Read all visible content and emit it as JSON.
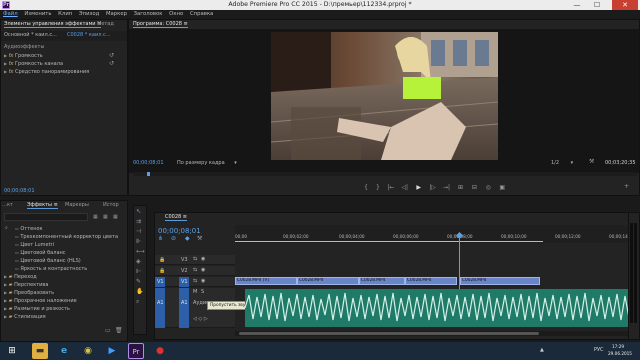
{
  "window": {
    "title": "Adobe Premiere Pro CC 2015 - D:\\премьер\\112334.prproj *",
    "app_icon": "Pr",
    "min": "—",
    "max": "☐",
    "close": "✕"
  },
  "menu": [
    "Файл",
    "Изменить",
    "Клип",
    "Эпизод",
    "Маркер",
    "Заголовок",
    "Окно",
    "Справка"
  ],
  "effect_controls": {
    "tabs": [
      "Элементы управления эффектами ≡",
      "Метад"
    ],
    "source_label": "Основной * каил.c...",
    "clip_label": "C0028 * каил.c...",
    "section": "Аудиоэффекты",
    "items": [
      {
        "name": "Громкость"
      },
      {
        "name": "Громкость канала"
      },
      {
        "name": "Средство панорамирования"
      }
    ],
    "timecode": "00;00;08;01"
  },
  "program_monitor": {
    "tab": "Программа: C0028 ≡",
    "timecode": "00;00;08;01",
    "fit": "По размеру кадра",
    "fit_arrow": "▾",
    "ratio": "1/2",
    "ratio_arrow": "▾",
    "duration": "00;03;20;35",
    "transport": [
      "{",
      "}",
      "|←",
      "◁|",
      "▶",
      "|▷",
      "→|",
      "⊞",
      "⊟",
      "◎",
      "▣"
    ],
    "add": "+"
  },
  "effects": {
    "tabs": [
      "…кт",
      "Эффекты ≡",
      "Маркеры",
      "Истор"
    ],
    "items": [
      {
        "name": "Оттенок",
        "kind": "fx",
        "indent": 1
      },
      {
        "name": "Трехкомпонентный корректор цвета",
        "kind": "fx",
        "indent": 1
      },
      {
        "name": "Цвет Lumetri",
        "kind": "fx",
        "indent": 1
      },
      {
        "name": "Цветовой баланс",
        "kind": "fx",
        "indent": 1
      },
      {
        "name": "Цветовой баланс (HLS)",
        "kind": "fx",
        "indent": 1
      },
      {
        "name": "Яркость и контрастность",
        "kind": "fx",
        "indent": 1
      },
      {
        "name": "Переход",
        "kind": "folder",
        "indent": 0
      },
      {
        "name": "Перспектива",
        "kind": "folder",
        "indent": 0
      },
      {
        "name": "Преобразовать",
        "kind": "folder",
        "indent": 0
      },
      {
        "name": "Прозрачное наложение",
        "kind": "folder",
        "indent": 0
      },
      {
        "name": "Размытие и резкость",
        "kind": "folder",
        "indent": 0
      },
      {
        "name": "Стилизация",
        "kind": "folder",
        "indent": 0
      }
    ]
  },
  "timeline": {
    "tab": "C0028 ≡",
    "timecode": "00;00;08;01",
    "ruler": [
      "00;00",
      "00;00;02;00",
      "00;00;04;00",
      "00;00;06;00",
      "00;00;08;00",
      "00;00;10;00",
      "00;00;12;00",
      "00;00;14;00"
    ],
    "tracks": {
      "v3": "V3",
      "v2": "V2",
      "v1": "V1",
      "a1": "A1",
      "a1_src": "A1",
      "v1_src": "V1",
      "m": "M",
      "s": "S",
      "tooltip": "Пропустить звук дорожки",
      "a1_label": "Аудио"
    },
    "clips": [
      {
        "name": "C0028.MP4 [V]"
      },
      {
        "name": "C0028.MP4"
      },
      {
        "name": "C0028.MP4"
      },
      {
        "name": "C0028.MP4"
      },
      {
        "name": "C0028.MP4"
      }
    ],
    "meter_labels": [
      "0",
      "-6",
      "-12",
      "-18",
      "-24",
      "-30",
      "-36",
      "-42",
      "-48",
      "-54"
    ]
  },
  "taskbar": {
    "lang": "РУС",
    "time": "17:29",
    "date": "29.06.2015",
    "pr": "Pr",
    "ie": "e",
    "chrome": "◉",
    "folder": "▬",
    "media": "▶",
    "rec": "●",
    "up": "▲"
  }
}
